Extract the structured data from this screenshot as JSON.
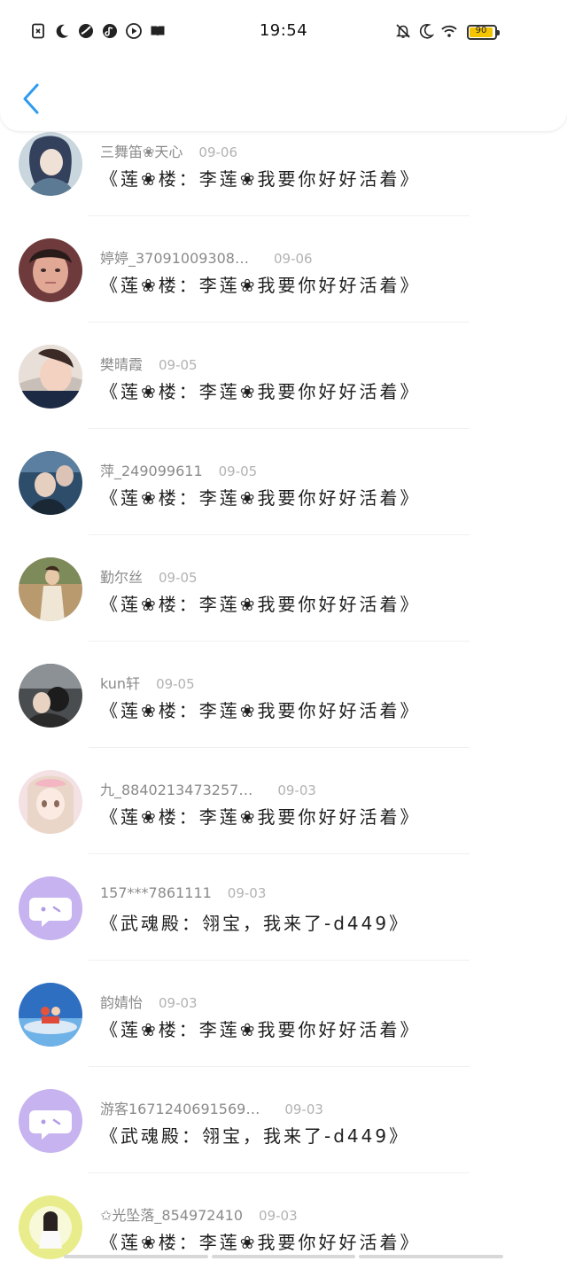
{
  "status_bar": {
    "time": "19:54",
    "battery_level": "90",
    "left_icons": [
      "sim-card-icon",
      "moon-icon",
      "app-icon",
      "music-icon",
      "video-icon",
      "book-icon"
    ],
    "right_icons": [
      "bell-off-icon",
      "moon-icon",
      "wifi-icon",
      "battery-icon"
    ]
  },
  "header": {
    "back_icon": "chevron-left-icon",
    "accent_color": "#2e9bf0"
  },
  "messages": [
    {
      "username": "三舞笛❀天心",
      "date": "09-06",
      "text": "《莲❀楼：李莲❀我要你好好活着》"
    },
    {
      "username": "婷婷_37091009308…",
      "date": "09-06",
      "text": "《莲❀楼：李莲❀我要你好好活着》"
    },
    {
      "username": "樊晴霞",
      "date": "09-05",
      "text": "《莲❀楼：李莲❀我要你好好活着》"
    },
    {
      "username": "萍_249099611",
      "date": "09-05",
      "text": "《莲❀楼：李莲❀我要你好好活着》"
    },
    {
      "username": "勤尔丝",
      "date": "09-05",
      "text": "《莲❀楼：李莲❀我要你好好活着》"
    },
    {
      "username": "kun轩",
      "date": "09-05",
      "text": "《莲❀楼：李莲❀我要你好好活着》"
    },
    {
      "username": "九_8840213473257…",
      "date": "09-03",
      "text": "《莲❀楼：李莲❀我要你好好活着》"
    },
    {
      "username": "157***7861111",
      "date": "09-03",
      "text": "《武魂殿：翎宝，我来了-d449》"
    },
    {
      "username": "韵婧怡",
      "date": "09-03",
      "text": "《莲❀楼：李莲❀我要你好好活着》"
    },
    {
      "username": "游客1671240691569…",
      "date": "09-03",
      "text": "《武魂殿：翎宝，我来了-d449》"
    },
    {
      "username": "✩光坠落_854972410",
      "date": "09-03",
      "text": "《莲❀楼：李莲❀我要你好好活着》"
    }
  ]
}
